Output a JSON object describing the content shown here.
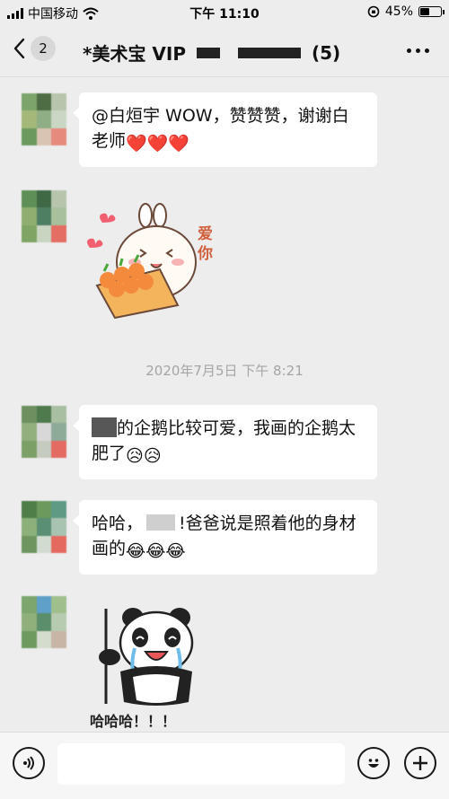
{
  "status_bar": {
    "carrier": "中国移动",
    "time": "下午 11:10",
    "battery": "45%",
    "battery_level": 0.45
  },
  "nav": {
    "unread_count": "2",
    "title_prefix": "*美术宝 VIP",
    "member_count": "(5)"
  },
  "messages": [
    {
      "type": "text",
      "text": "@白烜宇 WOW，赞赞赞，谢谢白老师",
      "emoji": "❤️❤️❤️",
      "emoji_name": "heart-icon"
    },
    {
      "type": "sticker",
      "sticker_text": "爱你",
      "sticker_name": "bunny-love-sticker"
    },
    {
      "type": "timestamp",
      "text": "2020年7月5日 下午 8:21"
    },
    {
      "type": "text",
      "text": "的企鹅比较可爱，我画的企鹅太肥了",
      "emoji": "😥😥",
      "emoji_name": "sweat-icon"
    },
    {
      "type": "text",
      "text": "哈哈，",
      "text2": "!爸爸说是照着他的身材画的",
      "emoji": "😂😂😂",
      "emoji_name": "laugh-cry-icon"
    },
    {
      "type": "sticker",
      "sticker_text": "哈哈哈！！！",
      "sticker_name": "panda-laugh-sticker"
    }
  ],
  "input": {
    "placeholder": ""
  },
  "colors": {
    "background": "#ededed",
    "bubble": "#ffffff",
    "timestamp": "#a5a5a5"
  }
}
